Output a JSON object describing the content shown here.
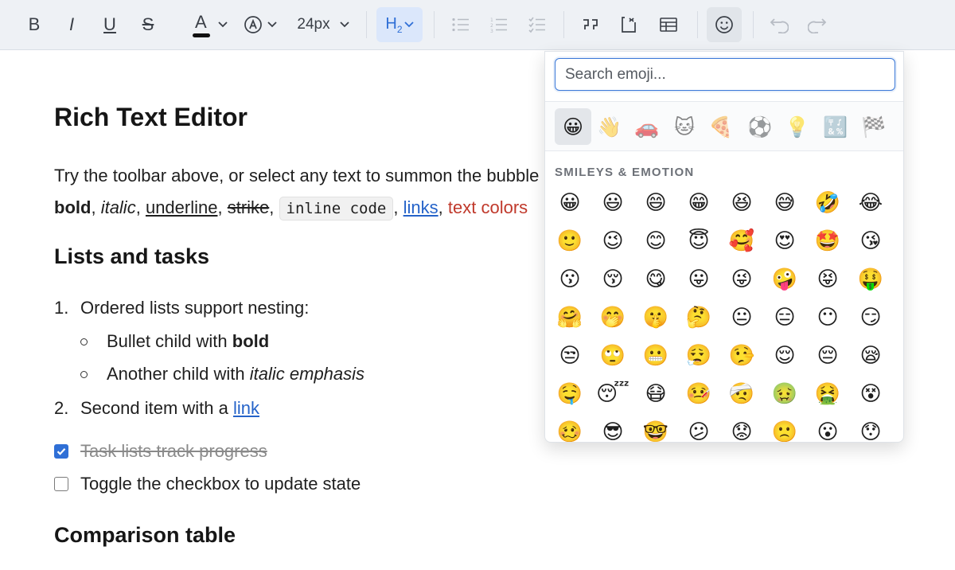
{
  "toolbar": {
    "bold": "B",
    "italic": "I",
    "underline": "U",
    "strike": "S",
    "text_color": "A",
    "text_color_swatch": "#111111",
    "font_size": "24px",
    "heading": "H",
    "heading_level": "2",
    "icons": {
      "bullet_list": "bullet-list-icon",
      "ordered_list": "ordered-list-icon",
      "task_list": "task-list-icon",
      "quote": "quote-icon",
      "code_block": "code-block-icon",
      "table": "table-icon",
      "emoji": "smiley-icon",
      "undo": "undo-icon",
      "redo": "redo-icon"
    },
    "accent": "#2f6fd6"
  },
  "doc": {
    "title": "Rich Text Editor",
    "para": {
      "intro": "Try the toolbar above, or select any text to summon the bubble menu. Marks like",
      "bold": "bold",
      "italic": "italic",
      "underline": "underline",
      "strike": "strike",
      "code": "inline code",
      "links": "links",
      "colors": "text colors",
      "comma": ","
    },
    "lists_heading": "Lists and tasks",
    "ordered": [
      {
        "num": "1.",
        "text": "Ordered lists support nesting:"
      },
      {
        "num": "2.",
        "text": "Second item with a ",
        "link": "link"
      }
    ],
    "bullets": [
      {
        "text": "Bullet child with ",
        "strong": "bold"
      },
      {
        "text": "Another child with ",
        "em": "italic emphasis"
      }
    ],
    "tasks": [
      {
        "text": "Task lists track progress",
        "checked": true
      },
      {
        "text": "Toggle the checkbox to update state",
        "checked": false
      }
    ],
    "table_heading": "Comparison table"
  },
  "emoji_picker": {
    "search_placeholder": "Search emoji...",
    "categories": [
      "😀",
      "👋",
      "🚗",
      "🐱",
      "🍕",
      "⚽",
      "💡",
      "🔣",
      "🏁"
    ],
    "section_title": "SMILEYS & EMOTION",
    "emojis": [
      "😀",
      "😃",
      "😄",
      "😁",
      "😆",
      "😅",
      "🤣",
      "😂",
      "🙂",
      "😉",
      "😊",
      "😇",
      "🥰",
      "😍",
      "🤩",
      "😘",
      "😗",
      "😚",
      "😋",
      "😛",
      "😜",
      "🤪",
      "😝",
      "🤑",
      "🤗",
      "🤭",
      "🤫",
      "🤔",
      "😐",
      "😑",
      "😶",
      "😏",
      "😒",
      "🙄",
      "😬",
      "😮‍💨",
      "🤥",
      "😌",
      "😔",
      "😪",
      "🤤",
      "😴",
      "😷",
      "🤒",
      "🤕",
      "🤢",
      "🤮",
      "😵",
      "🥴",
      "😎",
      "🤓",
      "😕",
      "😟",
      "🙁",
      "😮",
      "😯"
    ]
  }
}
